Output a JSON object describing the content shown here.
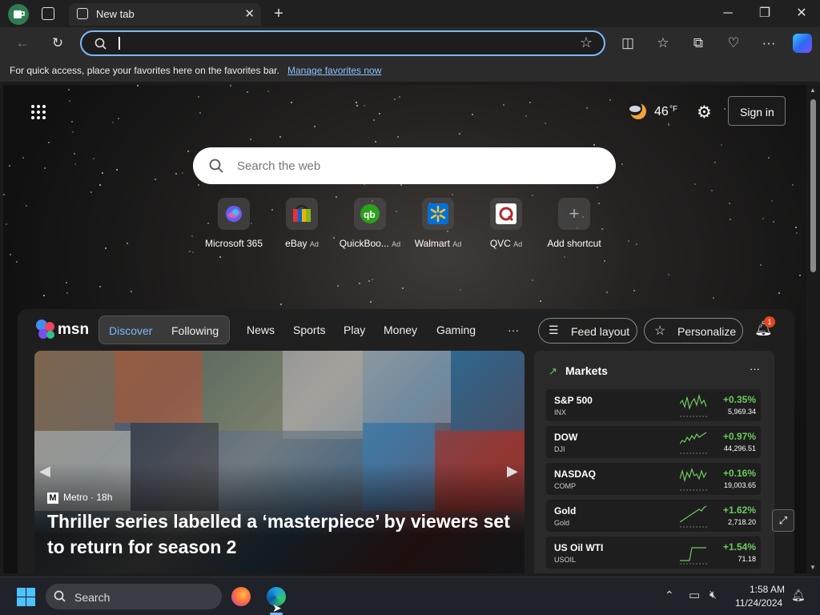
{
  "browser": {
    "tab_title": "New tab",
    "address_value": "",
    "favbar_text": "For quick access, place your favorites here on the favorites bar.",
    "favbar_link": "Manage favorites now"
  },
  "newtab": {
    "weather_temp": "46",
    "weather_unit": "°F",
    "sign_in": "Sign in",
    "search_placeholder": "Search the web",
    "tiles": [
      {
        "label": "Microsoft 365",
        "ad": ""
      },
      {
        "label": "eBay",
        "ad": "Ad"
      },
      {
        "label": "QuickBoo...",
        "ad": "Ad"
      },
      {
        "label": "Walmart",
        "ad": "Ad"
      },
      {
        "label": "QVC",
        "ad": "Ad"
      },
      {
        "label": "Add shortcut",
        "ad": ""
      }
    ]
  },
  "feed": {
    "brand": "msn",
    "tabs": [
      "Discover",
      "Following"
    ],
    "nav": [
      "News",
      "Sports",
      "Play",
      "Money",
      "Gaming",
      "···"
    ],
    "feed_layout": "Feed layout",
    "personalize": "Personalize",
    "notif_count": "1",
    "hero": {
      "source": "Metro",
      "age": "18h",
      "title": "Thriller series labelled a ‘masterpiece’ by viewers set to return for season 2"
    },
    "markets": {
      "title": "Markets",
      "more": "···",
      "rows": [
        {
          "name": "S&P 500",
          "sym": "INX",
          "change": "+0.35%",
          "value": "5,969.34"
        },
        {
          "name": "DOW",
          "sym": "DJI",
          "change": "+0.97%",
          "value": "44,296.51"
        },
        {
          "name": "NASDAQ",
          "sym": "COMP",
          "change": "+0.16%",
          "value": "19,003.65"
        },
        {
          "name": "Gold",
          "sym": "Gold",
          "change": "+1.62%",
          "value": "2,718.20"
        },
        {
          "name": "US Oil WTI",
          "sym": "USOIL",
          "change": "+1.54%",
          "value": "71.18"
        }
      ]
    }
  },
  "taskbar": {
    "search": "Search",
    "time": "1:58 AM",
    "date": "11/24/2024"
  },
  "colors": {
    "accent": "#7db9ff",
    "positive": "#6ccb5f",
    "notif": "#e0471e"
  }
}
